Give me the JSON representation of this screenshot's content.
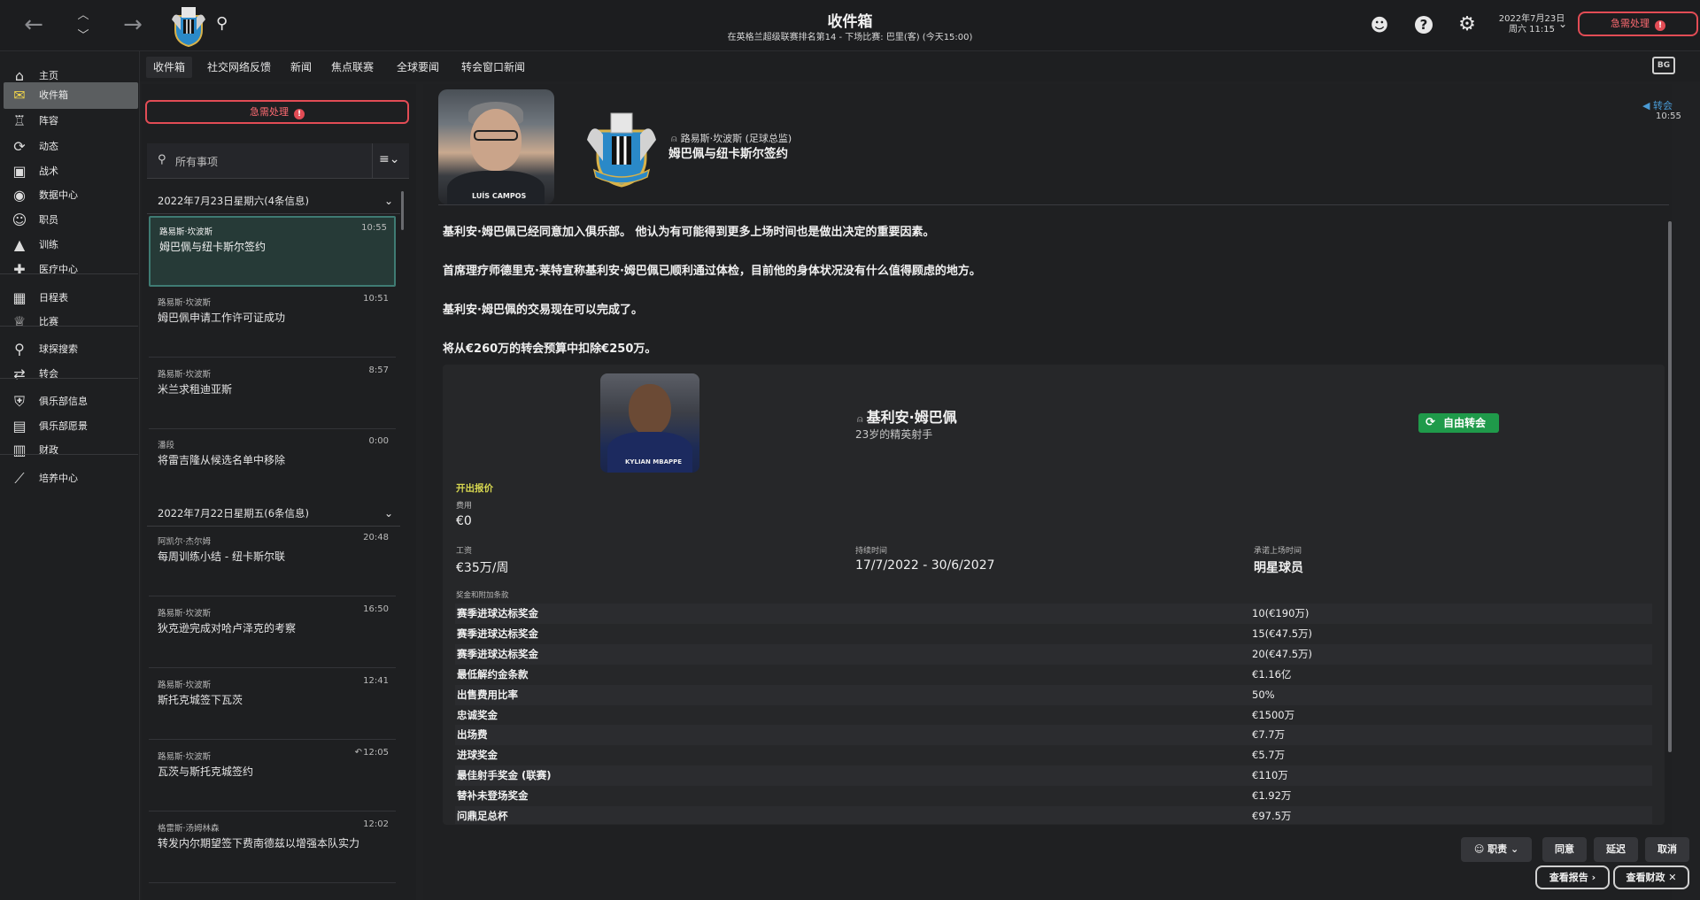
{
  "topbar": {
    "title": "收件箱",
    "subtitle": "在英格兰超级联赛排名第14 - 下场比赛: 巴里(客) (今天15:00)",
    "date_line1": "2022年7月23日",
    "date_line2": "周六 11:15",
    "urgent_label": "急需处理"
  },
  "sidebar": {
    "items": [
      {
        "label": "主页",
        "icon": "home-icon"
      },
      {
        "label": "收件箱",
        "icon": "inbox-icon"
      },
      {
        "label": "阵容",
        "icon": "shirt-icon"
      },
      {
        "label": "动态",
        "icon": "dynamics-icon"
      },
      {
        "label": "战术",
        "icon": "tactics-icon"
      },
      {
        "label": "数据中心",
        "icon": "data-icon"
      },
      {
        "label": "职员",
        "icon": "staff-icon"
      },
      {
        "label": "训练",
        "icon": "training-icon"
      },
      {
        "label": "医疗中心",
        "icon": "medical-icon"
      },
      {
        "label": "日程表",
        "icon": "calendar-icon"
      },
      {
        "label": "比赛",
        "icon": "trophy-icon"
      },
      {
        "label": "球探搜索",
        "icon": "scouting-icon"
      },
      {
        "label": "转会",
        "icon": "transfer-icon"
      },
      {
        "label": "俱乐部信息",
        "icon": "club-info-icon"
      },
      {
        "label": "俱乐部愿景",
        "icon": "vision-icon"
      },
      {
        "label": "财政",
        "icon": "finance-icon"
      },
      {
        "label": "培养中心",
        "icon": "development-icon"
      }
    ]
  },
  "subtabs": [
    "收件箱",
    "社交网络反馈",
    "新闻",
    "焦点联赛",
    "全球要闻",
    "转会窗口新闻"
  ],
  "inbox": {
    "urgent_label": "急需处理",
    "search_placeholder": "所有事项",
    "groups": [
      {
        "header": "2022年7月23日星期六(4条信息)"
      },
      {
        "header": "2022年7月22日星期五(6条信息)"
      }
    ],
    "messages": [
      {
        "from": "路易斯·坎波斯",
        "time": "10:55",
        "subject": "姆巴佩与纽卡斯尔签约"
      },
      {
        "from": "路易斯·坎波斯",
        "time": "10:51",
        "subject": "姆巴佩申请工作许可证成功"
      },
      {
        "from": "路易斯·坎波斯",
        "time": "8:57",
        "subject": "米兰求租迪亚斯"
      },
      {
        "from": "潘段",
        "time": "0:00",
        "subject": "将雷吉隆从候选名单中移除"
      },
      {
        "from": "阿凯尔·杰尔姆",
        "time": "20:48",
        "subject": "每周训练小结 - 纽卡斯尔联"
      },
      {
        "from": "路易斯·坎波斯",
        "time": "16:50",
        "subject": "狄克逊完成对哈卢泽克的考察"
      },
      {
        "from": "路易斯·坎波斯",
        "time": "12:41",
        "subject": "斯托克城签下瓦茨"
      },
      {
        "from": "路易斯·坎波斯",
        "time": "12:05",
        "subject": "瓦茨与斯托克城签约"
      },
      {
        "from": "格雷斯·汤姆林森",
        "time": "12:02",
        "subject": "转发内尔期望签下费南德兹以增强本队实力"
      }
    ]
  },
  "reader": {
    "portrait_name": "LUÍS CAMPOS",
    "sender": "路易斯·坎波斯 (足球总监)",
    "subject": "姆巴佩与纽卡斯尔签约",
    "tag": "转会",
    "time": "10:55",
    "paragraphs": [
      "基利安·姆巴佩已经同意加入俱乐部。 他认为有可能得到更多上场时间也是做出决定的重要因素。",
      "首席理疗师德里克·莱特宣称基利安·姆巴佩已顺利通过体检，目前他的身体状况没有什么值得顾虑的地方。",
      "基利安·姆巴佩的交易现在可以完成了。",
      "将从€260万的转会预算中扣除€250万。"
    ],
    "player": {
      "photo_name": "KYLIAN MBAPPE",
      "name": "基利安·姆巴佩",
      "desc": "23岁的精英射手",
      "badge": "自由转会"
    },
    "offer": {
      "header": "开出报价",
      "fee_label": "费用",
      "fee": "€0",
      "wage_label": "工资",
      "wage": "€35万/周",
      "duration_label": "持续时间",
      "duration": "17/7/2022 - 30/6/2027",
      "playing_time_label": "承诺上场时间",
      "playing_time": "明星球员",
      "bonus_label": "奖金和附加条款",
      "bonuses": [
        {
          "k": "赛季进球达标奖金",
          "v": "10(€190万)"
        },
        {
          "k": "赛季进球达标奖金",
          "v": "15(€47.5万)"
        },
        {
          "k": "赛季进球达标奖金",
          "v": "20(€47.5万)"
        },
        {
          "k": "最低解约金条款",
          "v": "€1.16亿"
        },
        {
          "k": "出售费用比率",
          "v": "50%"
        },
        {
          "k": "忠诚奖金",
          "v": "€1500万"
        },
        {
          "k": "出场费",
          "v": "€7.7万"
        },
        {
          "k": "进球奖金",
          "v": "€5.7万"
        },
        {
          "k": "最佳射手奖金 (联赛)",
          "v": "€110万"
        },
        {
          "k": "替补未登场奖金",
          "v": "€1.92万"
        },
        {
          "k": "问鼎足总杯",
          "v": "€97.5万"
        }
      ]
    },
    "actions": {
      "staff": "职责",
      "agree": "同意",
      "delay": "延迟",
      "cancel": "取消",
      "view_report": "查看报告",
      "view_finance": "查看财政"
    }
  },
  "colors": {
    "accent_red": "#e24c55",
    "selected_teal": "#263a37",
    "free_green": "#1f9a4a",
    "offer_yellow": "#d7d750"
  }
}
